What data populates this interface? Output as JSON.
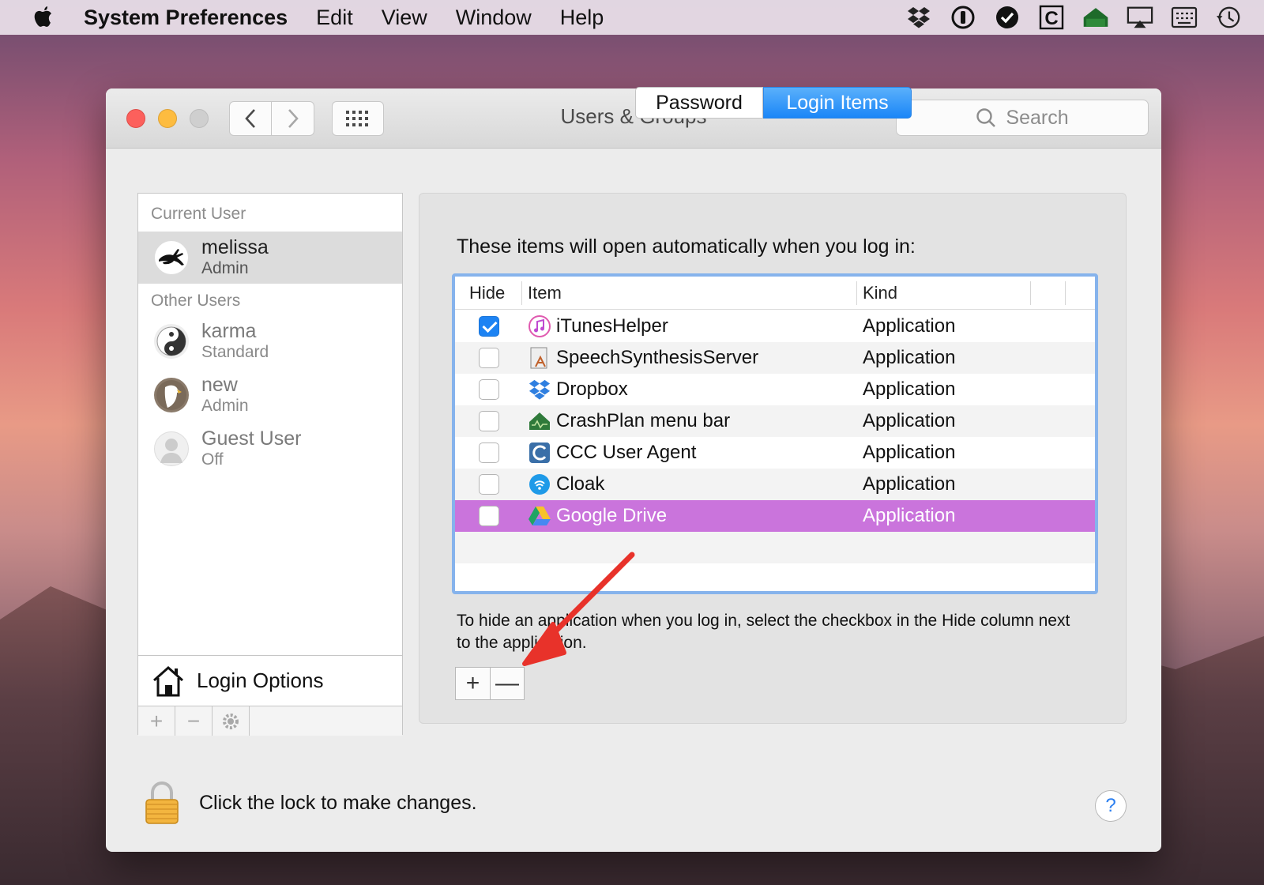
{
  "menubar": {
    "app_name": "System Preferences",
    "items": [
      "Edit",
      "View",
      "Window",
      "Help"
    ],
    "tray_icons": [
      "dropbox-icon",
      "1password-icon",
      "check-icon",
      "ccc-icon",
      "crashplan-icon",
      "airplay-icon",
      "keyboard-viewer-icon",
      "time-machine-icon"
    ]
  },
  "window": {
    "title": "Users & Groups",
    "search_placeholder": "Search"
  },
  "users": {
    "current_label": "Current User",
    "other_label": "Other Users",
    "current": {
      "name": "melissa",
      "role": "Admin"
    },
    "others": [
      {
        "name": "karma",
        "role": "Standard"
      },
      {
        "name": "new",
        "role": "Admin"
      },
      {
        "name": "Guest User",
        "role": "Off"
      }
    ],
    "login_options": "Login Options"
  },
  "tabs": {
    "password": "Password",
    "login_items": "Login Items",
    "active": "Login Items"
  },
  "login_items": {
    "intro": "These items will open automatically when you log in:",
    "columns": {
      "hide": "Hide",
      "item": "Item",
      "kind": "Kind"
    },
    "rows": [
      {
        "name": "iTunesHelper",
        "kind": "Application",
        "hidden": true,
        "icon": "itunes-icon"
      },
      {
        "name": "SpeechSynthesisServer",
        "kind": "Application",
        "hidden": false,
        "icon": "speech-synthesis-icon"
      },
      {
        "name": "Dropbox",
        "kind": "Application",
        "hidden": false,
        "icon": "dropbox-icon"
      },
      {
        "name": "CrashPlan menu bar",
        "kind": "Application",
        "hidden": false,
        "icon": "crashplan-icon"
      },
      {
        "name": "CCC User Agent",
        "kind": "Application",
        "hidden": false,
        "icon": "ccc-icon"
      },
      {
        "name": "Cloak",
        "kind": "Application",
        "hidden": false,
        "icon": "cloak-icon"
      },
      {
        "name": "Google Drive",
        "kind": "Application",
        "hidden": false,
        "icon": "google-drive-icon",
        "selected": true
      }
    ],
    "hint": "To hide an application when you log in, select the checkbox in the Hide column next to the application.",
    "add_label": "+",
    "remove_label": "—"
  },
  "footer": {
    "lock_text": "Click the lock to make changes.",
    "help_label": "?"
  },
  "colors": {
    "selected_row": "#ca74dc",
    "accent_blue": "#1d83f3",
    "annotation_arrow": "#e8322a"
  }
}
